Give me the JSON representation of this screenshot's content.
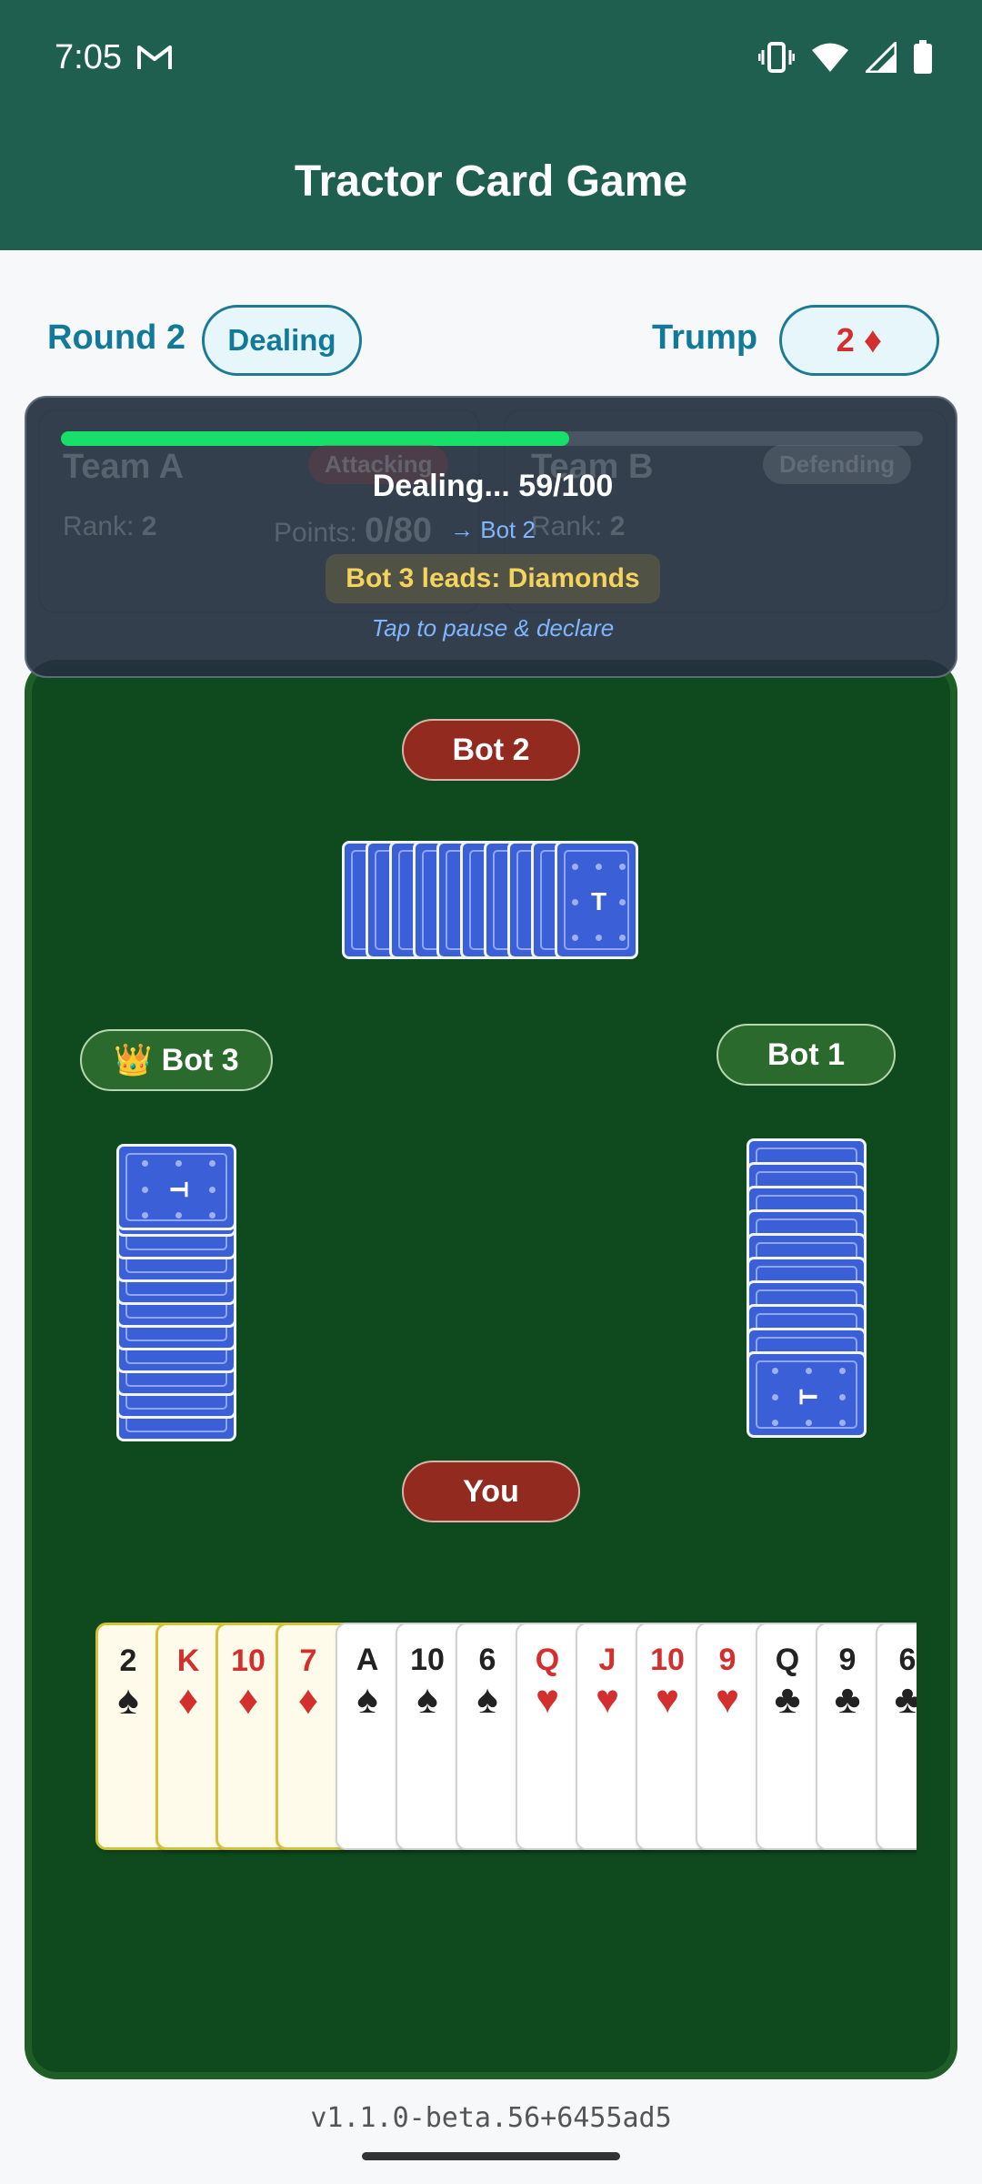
{
  "status": {
    "time": "7:05"
  },
  "app": {
    "title": "Tractor Card Game"
  },
  "info": {
    "round_label": "Round 2",
    "phase": "Dealing",
    "trump_label": "Trump",
    "trump_rank": "2",
    "trump_suit": "♦"
  },
  "teams": [
    {
      "name": "Team A",
      "role": "Attacking",
      "rank_label": "Rank:",
      "rank": "2",
      "points_label": "Points:",
      "points": "0/80"
    },
    {
      "name": "Team B",
      "role": "Defending",
      "rank_label": "Rank:",
      "rank": "2"
    }
  ],
  "overlay": {
    "progress": 0.59,
    "dealing_text": "Dealing... 59/100",
    "next_player": "→ Bot 2",
    "lead_text": "Bot 3 leads: Diamonds",
    "hint": "Tap to pause & declare"
  },
  "players": {
    "north": "Bot 2",
    "west": "Bot 3",
    "west_crown": "👑",
    "east": "Bot 1",
    "south": "You"
  },
  "card_back_label": "T",
  "hand": [
    {
      "rank": "2",
      "suit": "♠",
      "color": "black",
      "highlight": true
    },
    {
      "rank": "K",
      "suit": "♦",
      "color": "red",
      "highlight": true
    },
    {
      "rank": "10",
      "suit": "♦",
      "color": "red",
      "highlight": true
    },
    {
      "rank": "7",
      "suit": "♦",
      "color": "red",
      "highlight": true
    },
    {
      "rank": "A",
      "suit": "♠",
      "color": "black",
      "highlight": false
    },
    {
      "rank": "10",
      "suit": "♠",
      "color": "black",
      "highlight": false
    },
    {
      "rank": "6",
      "suit": "♠",
      "color": "black",
      "highlight": false
    },
    {
      "rank": "Q",
      "suit": "♥",
      "color": "red",
      "highlight": false
    },
    {
      "rank": "J",
      "suit": "♥",
      "color": "red",
      "highlight": false
    },
    {
      "rank": "10",
      "suit": "♥",
      "color": "red",
      "highlight": false
    },
    {
      "rank": "9",
      "suit": "♥",
      "color": "red",
      "highlight": false
    },
    {
      "rank": "Q",
      "suit": "♣",
      "color": "black",
      "highlight": false
    },
    {
      "rank": "9",
      "suit": "♣",
      "color": "black",
      "highlight": false
    },
    {
      "rank": "6",
      "suit": "♣",
      "color": "black",
      "highlight": false
    }
  ],
  "version": "v1.1.0-beta.56+6455ad5"
}
